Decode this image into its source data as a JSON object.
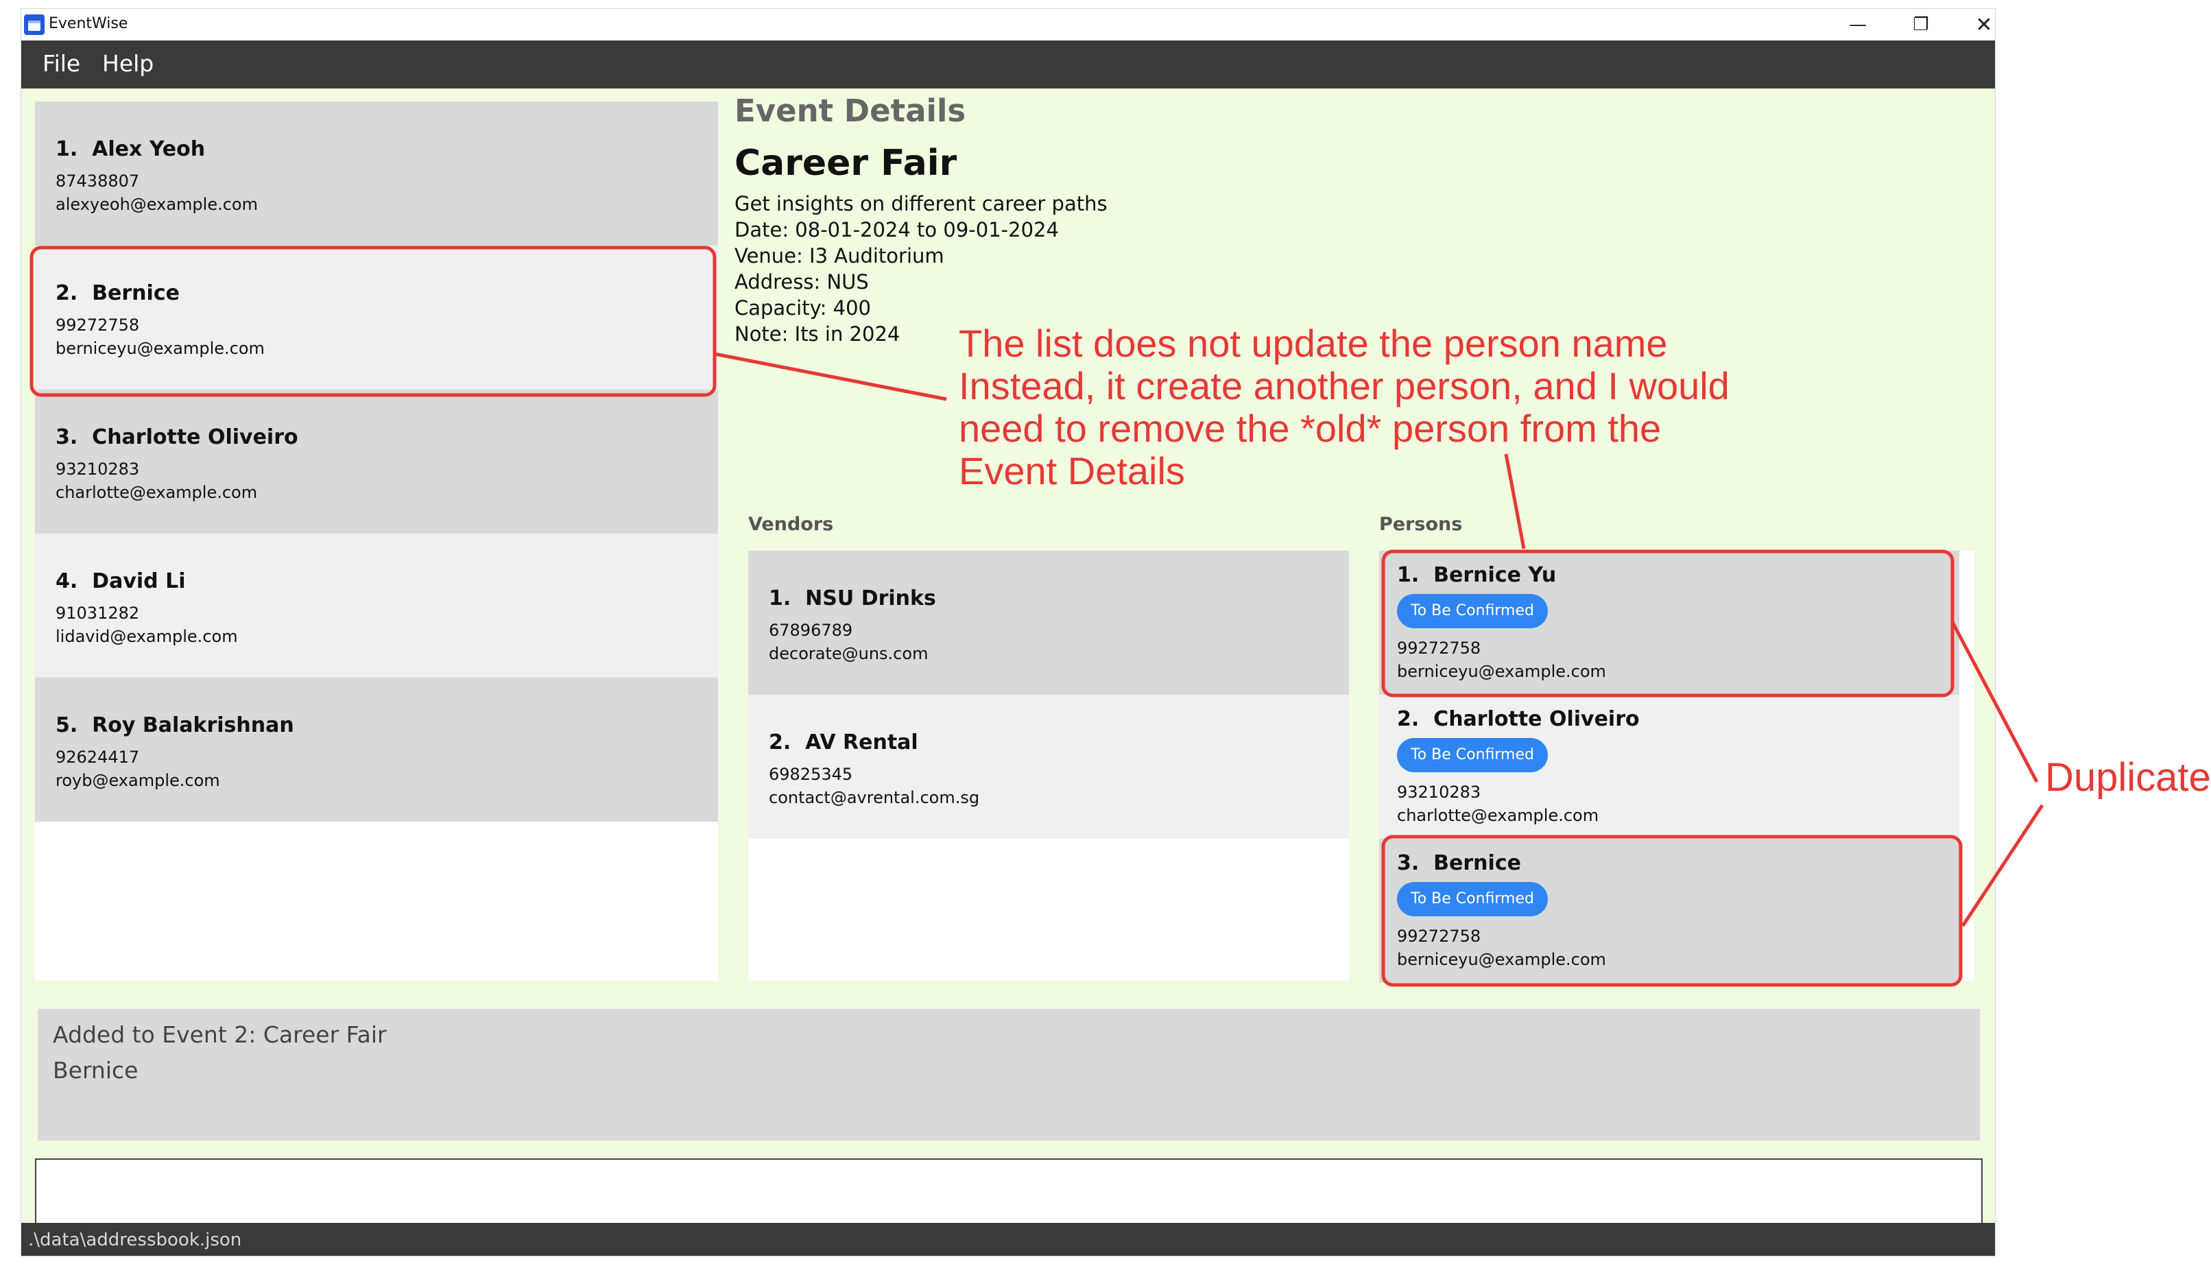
{
  "window": {
    "title": "EventWise",
    "controls": {
      "minimize": "—",
      "maximize": "❐",
      "close": "✕"
    }
  },
  "menu": {
    "file": "File",
    "help": "Help"
  },
  "persons": [
    {
      "index": "1.",
      "name": "Alex Yeoh",
      "phone": "87438807",
      "email": "alexyeoh@example.com"
    },
    {
      "index": "2.",
      "name": "Bernice",
      "phone": "99272758",
      "email": "berniceyu@example.com"
    },
    {
      "index": "3.",
      "name": "Charlotte Oliveiro",
      "phone": "93210283",
      "email": "charlotte@example.com"
    },
    {
      "index": "4.",
      "name": "David Li",
      "phone": "91031282",
      "email": "lidavid@example.com"
    },
    {
      "index": "5.",
      "name": "Roy Balakrishnan",
      "phone": "92624417",
      "email": "royb@example.com"
    }
  ],
  "event": {
    "header": "Event Details",
    "name": "Career Fair",
    "description": "Get insights on different career paths",
    "date": "Date: 08-01-2024 to 09-01-2024",
    "venue": "Venue: I3 Auditorium",
    "address": "Address: NUS",
    "capacity": "Capacity: 400",
    "note": "Note: Its in 2024",
    "vendors_label": "Vendors",
    "persons_label": "Persons",
    "vendors": [
      {
        "index": "1.",
        "name": "NSU Drinks",
        "phone": "67896789",
        "email": "decorate@uns.com"
      },
      {
        "index": "2.",
        "name": "AV Rental",
        "phone": "69825345",
        "email": "contact@avrental.com.sg"
      }
    ],
    "persons": [
      {
        "index": "1.",
        "name": "Bernice Yu",
        "status": "To Be Confirmed",
        "phone": "99272758",
        "email": "berniceyu@example.com"
      },
      {
        "index": "2.",
        "name": "Charlotte Oliveiro",
        "status": "To Be Confirmed",
        "phone": "93210283",
        "email": "charlotte@example.com"
      },
      {
        "index": "3.",
        "name": "Bernice",
        "status": "To Be Confirmed",
        "phone": "99272758",
        "email": "berniceyu@example.com"
      }
    ]
  },
  "result": {
    "line1": "Added to Event 2: Career Fair",
    "line2": "Bernice"
  },
  "command": {
    "value": ""
  },
  "status": {
    "path": ".\\data\\addressbook.json"
  },
  "annotations": {
    "explanation": [
      "The list does not update the person name",
      "Instead, it create another person, and I would",
      "need to remove the *old* person from the",
      "Event Details"
    ],
    "duplicate": "Duplicate",
    "color": "#e53935"
  },
  "colors": {
    "background": "#f0fbe0",
    "menubar": "#3a3a3a",
    "card_grey": "#d9d9d9",
    "card_light": "#f0f0f0",
    "badge": "#2f86f2",
    "annotation": "#e53935"
  }
}
